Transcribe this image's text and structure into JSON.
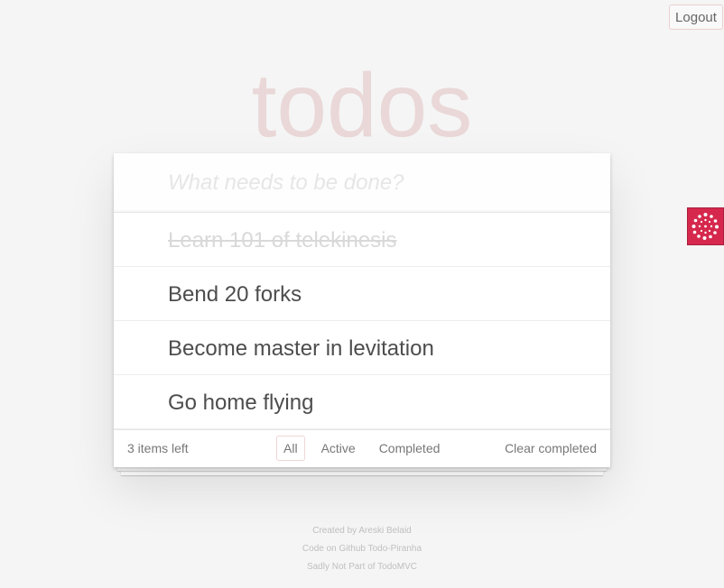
{
  "header": {
    "logout_label": "Logout",
    "title": "todos"
  },
  "new_todo": {
    "placeholder": "What needs to be done?",
    "value": ""
  },
  "todos": [
    {
      "label": "Learn 101 of telekinesis",
      "completed": true
    },
    {
      "label": "Bend 20 forks",
      "completed": false
    },
    {
      "label": "Become master in levitation",
      "completed": false
    },
    {
      "label": "Go home flying",
      "completed": false
    }
  ],
  "footer": {
    "count_text": "3 items left",
    "filters": [
      {
        "label": "All",
        "selected": true
      },
      {
        "label": "Active",
        "selected": false
      },
      {
        "label": "Completed",
        "selected": false
      }
    ],
    "clear_completed_label": "Clear completed"
  },
  "info": {
    "line1": "Created by Areski Belaid",
    "line2": "Code on Github Todo-Piranha",
    "line3": "Sadly Not Part of TodoMVC"
  },
  "widget": {
    "icon": "dotted-circle-logo-icon",
    "color": "#d6284d"
  },
  "colors": {
    "accent": "#af2f2f",
    "background": "#f5f5f5"
  }
}
